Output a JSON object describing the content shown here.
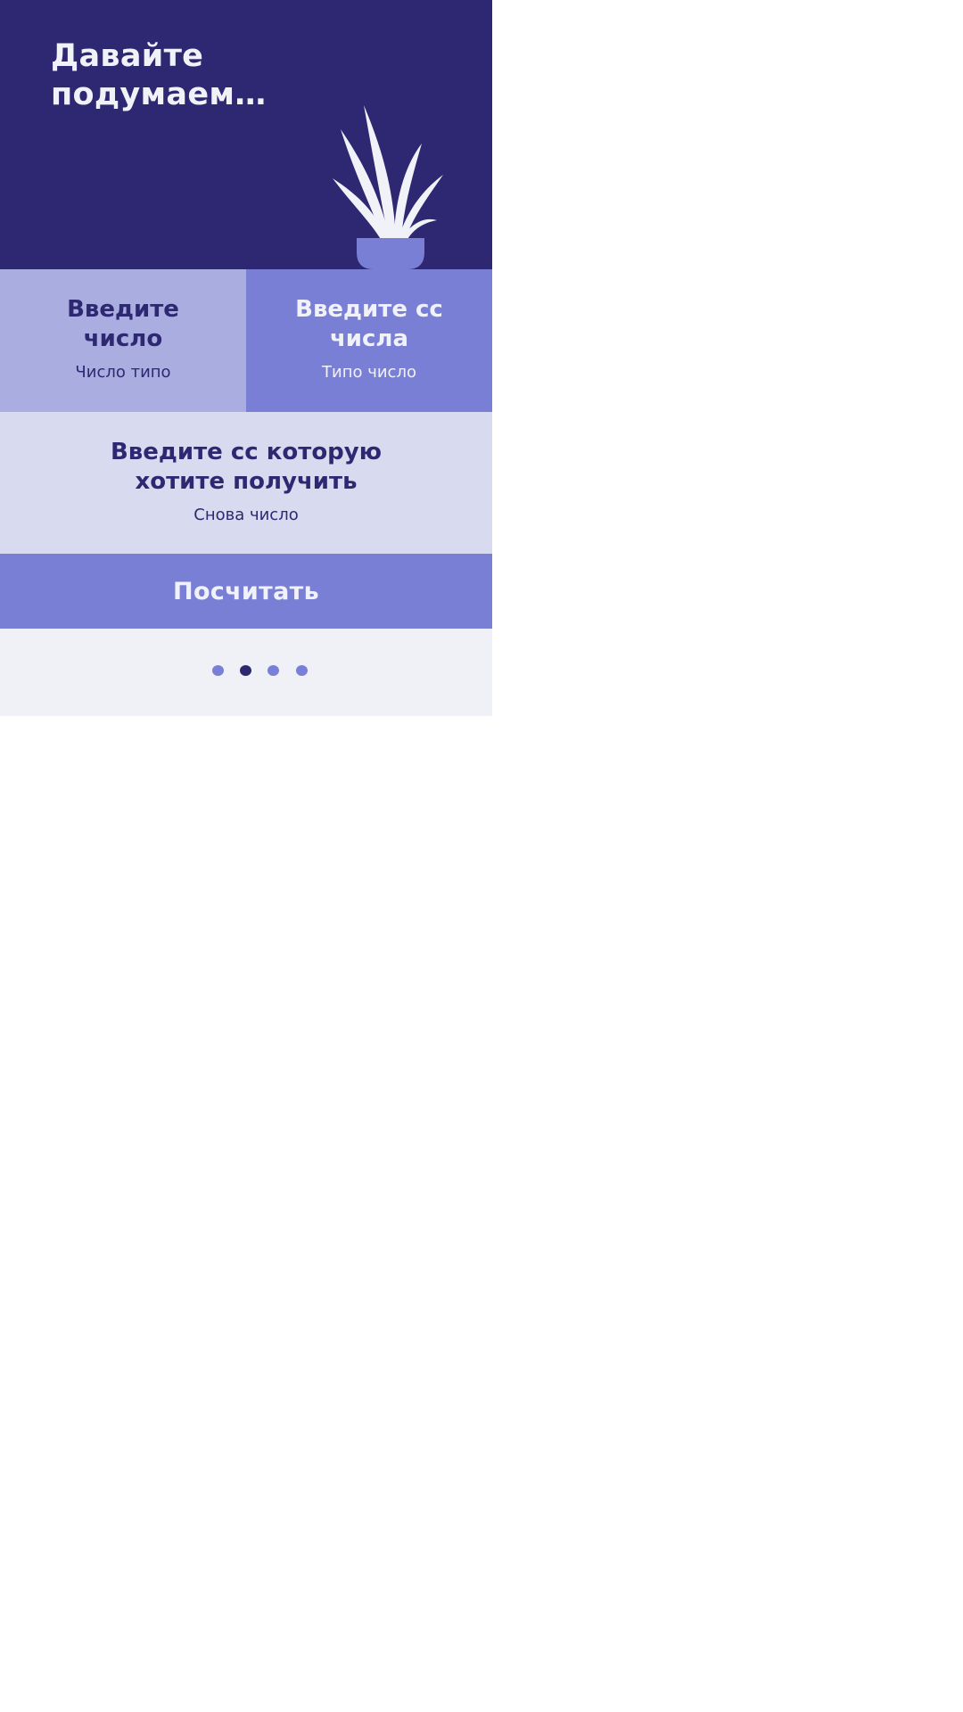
{
  "header": {
    "title": "Давайте подумаем…",
    "illustration": "potted-plant"
  },
  "inputs": {
    "number": {
      "label": "Введите число",
      "placeholder": "Число типо"
    },
    "source_base": {
      "label": "Введите сс числа",
      "placeholder": "Типо число"
    },
    "target_base": {
      "label": "Введите сс которую хотите получить",
      "placeholder": "Снова число"
    }
  },
  "actions": {
    "calculate_label": "Посчитать"
  },
  "pager": {
    "total": 4,
    "active_index": 1
  },
  "colors": {
    "dark_indigo": "#2e2872",
    "periwinkle": "#7a7fd6",
    "light_periwinkle": "#a9addf",
    "pale_lavender": "#d8daef",
    "background": "#f0f1f6",
    "text_light": "#f1f2f8"
  }
}
